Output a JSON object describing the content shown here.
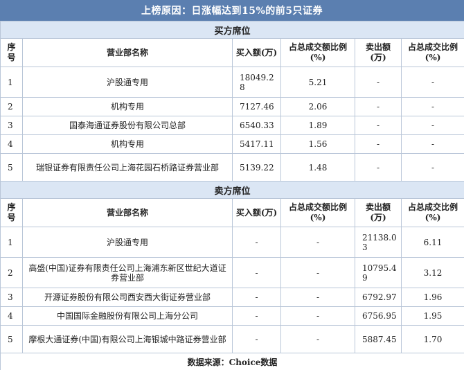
{
  "title": "上榜原因：日涨幅达到15%的前5只证券",
  "buy": {
    "section_title": "买方席位",
    "headers": [
      "序号",
      "营业部名称",
      "买入额(万)",
      "占总成交额比例(%)",
      "卖出额(万)",
      "占总成交比例(%)"
    ],
    "rows": [
      {
        "idx": "1",
        "name": "沪股通专用",
        "buy": "18049.28",
        "buy_pct": "5.21",
        "sell": "-",
        "sell_pct": "-"
      },
      {
        "idx": "2",
        "name": "机构专用",
        "buy": "7127.46",
        "buy_pct": "2.06",
        "sell": "-",
        "sell_pct": "-"
      },
      {
        "idx": "3",
        "name": "国泰海通证券股份有限公司总部",
        "buy": "6540.33",
        "buy_pct": "1.89",
        "sell": "-",
        "sell_pct": "-"
      },
      {
        "idx": "4",
        "name": "机构专用",
        "buy": "5417.11",
        "buy_pct": "1.56",
        "sell": "-",
        "sell_pct": "-"
      },
      {
        "idx": "5",
        "name": "瑞银证券有限责任公司上海花园石桥路证券营业部",
        "buy": "5139.22",
        "buy_pct": "1.48",
        "sell": "-",
        "sell_pct": "-"
      }
    ]
  },
  "sell": {
    "section_title": "卖方席位",
    "headers": [
      "序号",
      "营业部名称",
      "买入额(万)",
      "占总成交额比例(%)",
      "卖出额(万)",
      "占总成交比例(%)"
    ],
    "rows": [
      {
        "idx": "1",
        "name": "沪股通专用",
        "buy": "-",
        "buy_pct": "-",
        "sell": "21138.03",
        "sell_pct": "6.11"
      },
      {
        "idx": "2",
        "name": "高盛(中国)证券有限责任公司上海浦东新区世纪大道证券营业部",
        "buy": "-",
        "buy_pct": "-",
        "sell": "10795.49",
        "sell_pct": "3.12"
      },
      {
        "idx": "3",
        "name": "开源证券股份有限公司西安西大街证券营业部",
        "buy": "-",
        "buy_pct": "-",
        "sell": "6792.97",
        "sell_pct": "1.96"
      },
      {
        "idx": "4",
        "name": "中国国际金融股份有限公司上海分公司",
        "buy": "-",
        "buy_pct": "-",
        "sell": "6756.95",
        "sell_pct": "1.95"
      },
      {
        "idx": "5",
        "name": "摩根大通证券(中国)有限公司上海银城中路证券营业部",
        "buy": "-",
        "buy_pct": "-",
        "sell": "5887.45",
        "sell_pct": "1.70"
      }
    ]
  },
  "footer": "数据来源：Choice数据"
}
